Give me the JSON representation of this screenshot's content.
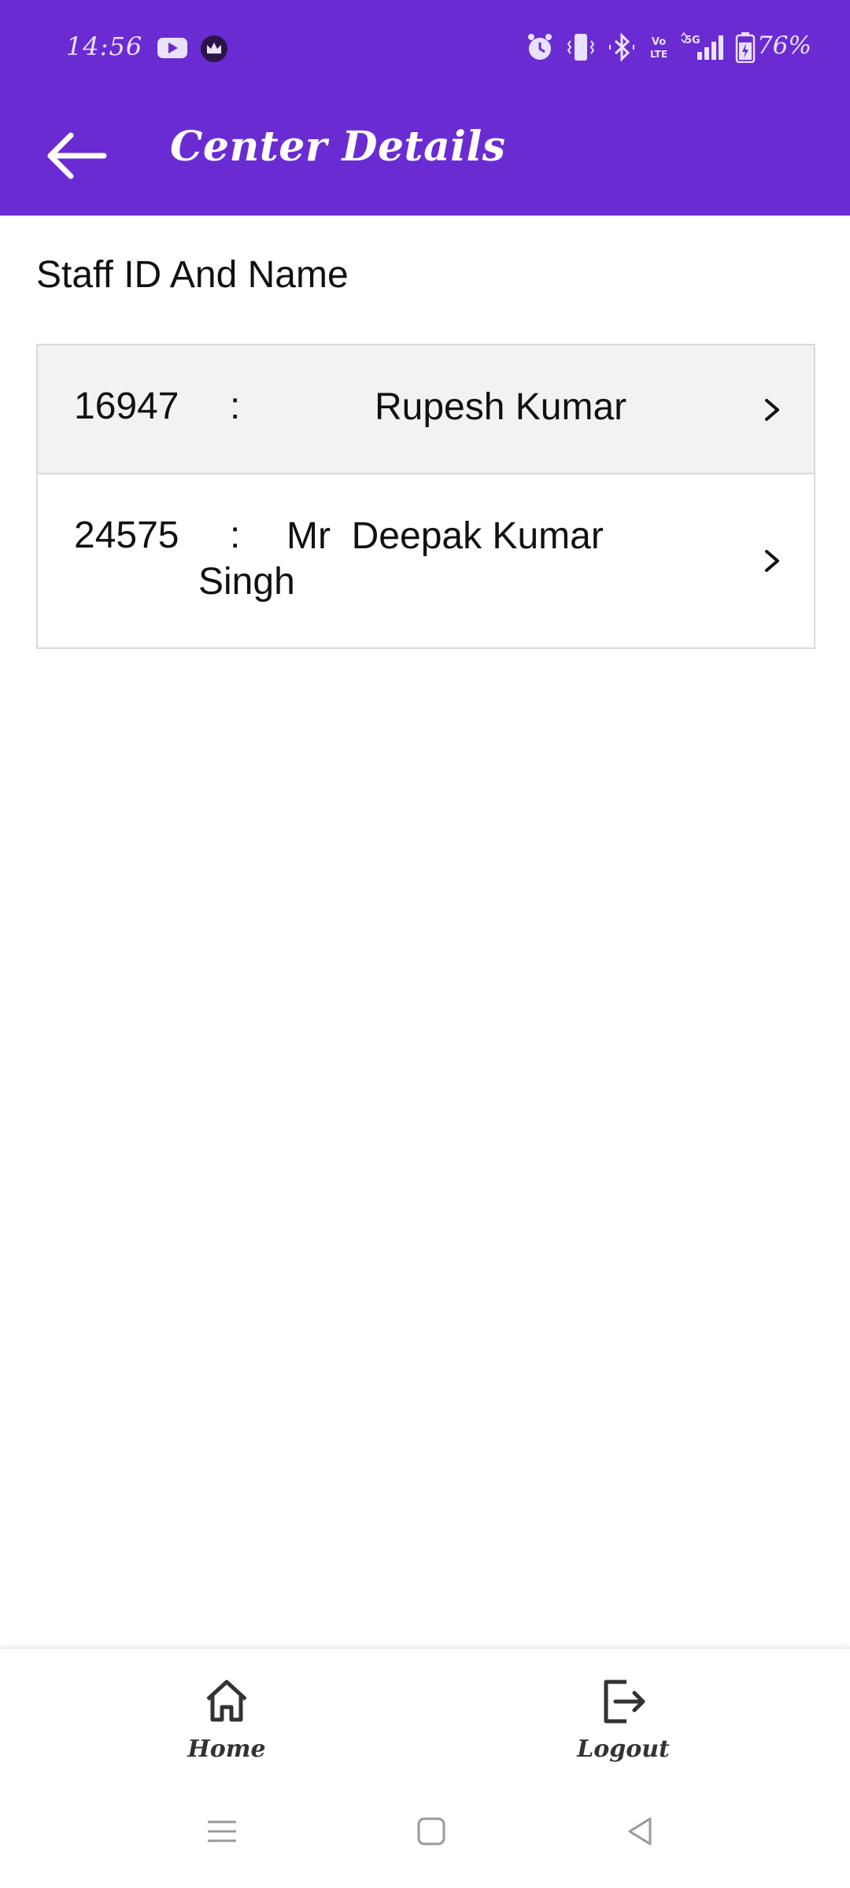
{
  "status_bar": {
    "time": "14:56",
    "battery_percent": "76%",
    "icons": [
      "youtube-icon",
      "crown-app-icon",
      "alarm-icon",
      "vibrate-icon",
      "bluetooth-icon",
      "volte-icon",
      "5g-signal-icon",
      "battery-charging-icon"
    ]
  },
  "app_bar": {
    "title": "Center Details",
    "back_icon": "arrow-left-icon",
    "background_color": "#6a2bd3"
  },
  "section": {
    "heading": "Staff ID And Name"
  },
  "staff": [
    {
      "id": "16947",
      "separator": ":",
      "name": "Rupesh Kumar"
    },
    {
      "id": "24575",
      "separator": ":",
      "name": "Mr  Deepak Kumar Singh"
    }
  ],
  "bottom_nav": {
    "home_label": "Home",
    "logout_label": "Logout"
  },
  "system_nav": {
    "icons": [
      "menu-icon",
      "home-square-icon",
      "back-triangle-icon"
    ]
  }
}
